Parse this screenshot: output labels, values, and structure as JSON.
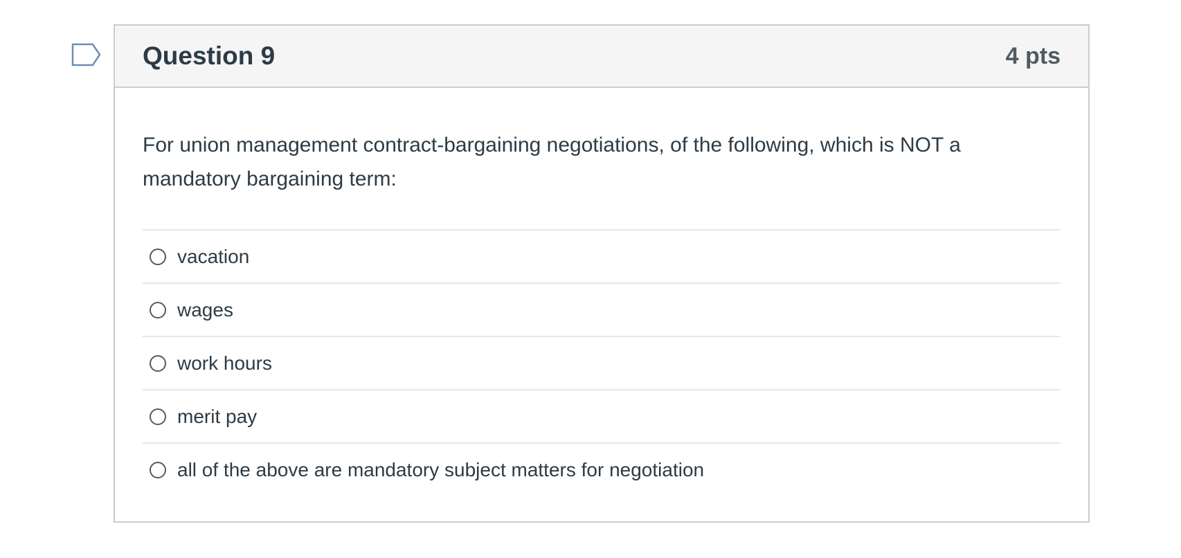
{
  "question": {
    "title": "Question 9",
    "points": "4 pts",
    "text": "For union management contract-bargaining negotiations, of the following, which is NOT a mandatory bargaining term:",
    "flag_icon": "flag-outline-icon",
    "answers": [
      {
        "label": "vacation",
        "selected": false
      },
      {
        "label": "wages",
        "selected": false
      },
      {
        "label": "work hours",
        "selected": false
      },
      {
        "label": "merit pay",
        "selected": false
      },
      {
        "label": "all of the above are mandatory subject matters for negotiation",
        "selected": false
      }
    ]
  },
  "colors": {
    "text": "#2d3b45",
    "header_bg": "#f5f5f5",
    "border": "#c7cdd1",
    "flag": "#6b8fb3"
  }
}
